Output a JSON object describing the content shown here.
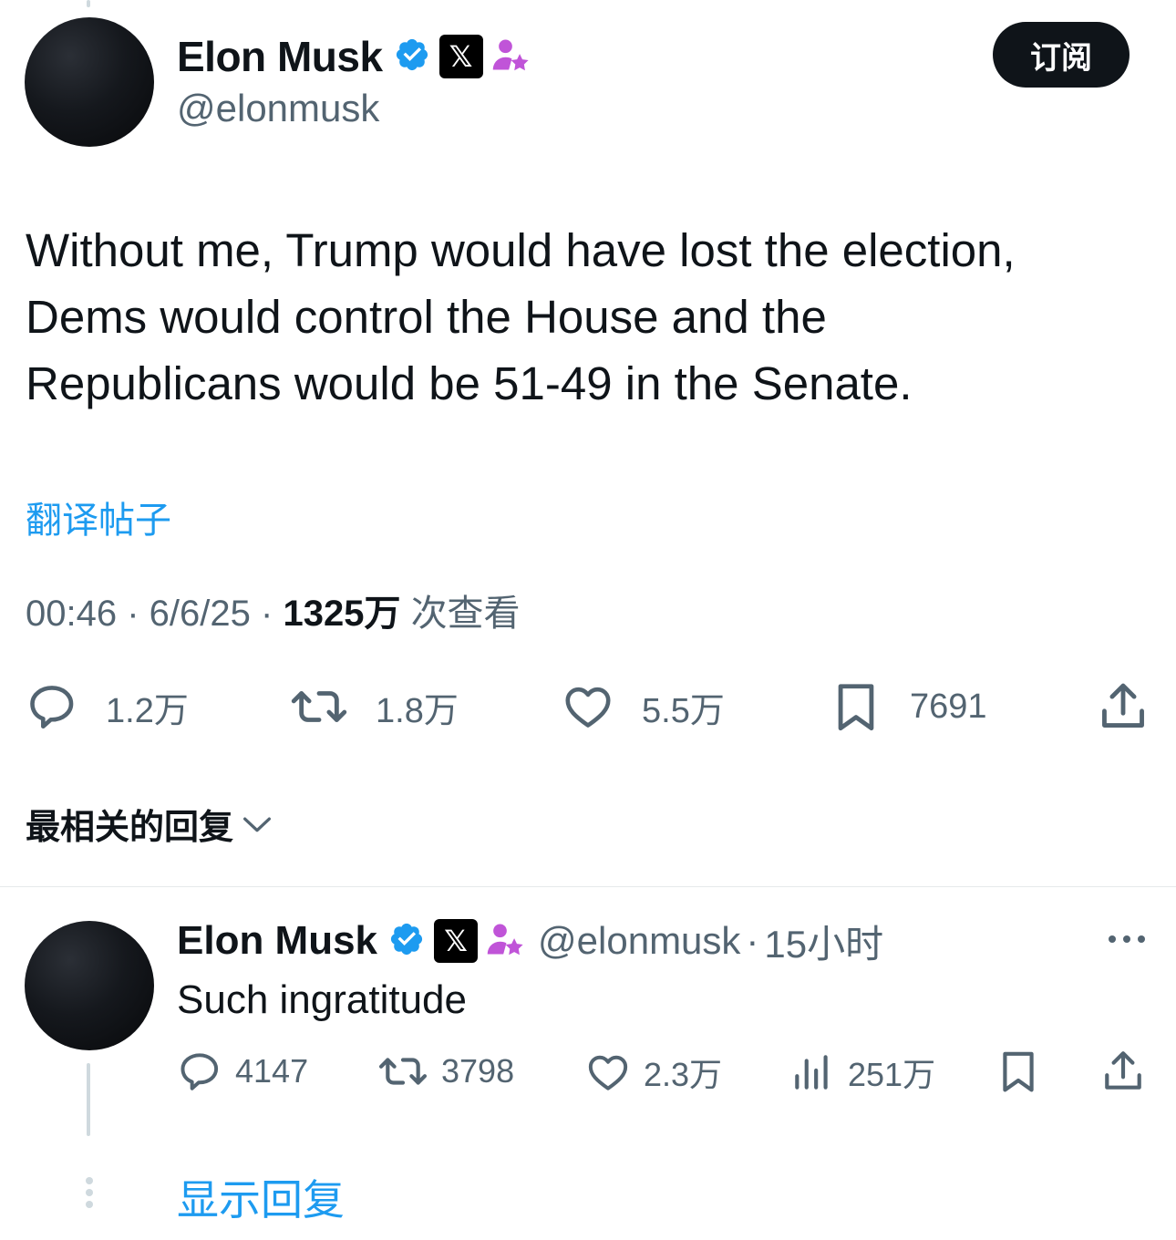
{
  "tweet": {
    "author": {
      "name": "Elon Musk",
      "handle": "@elonmusk"
    },
    "subscribe_label": "订阅",
    "text_lines": [
      "Without me, Trump would have lost the election,",
      "Dems would control the House and the",
      "Republicans would be 51-49 in the Senate."
    ],
    "translate_label": "翻译帖子",
    "time": "00:46",
    "date": "6/6/25",
    "views_count": "1325万",
    "views_label": "次查看",
    "stats": {
      "replies": "1.2万",
      "reposts": "1.8万",
      "likes": "5.5万",
      "bookmarks": "7691"
    }
  },
  "replies_sort": {
    "label": "最相关的回复"
  },
  "reply": {
    "author": {
      "name": "Elon Musk",
      "handle": "@elonmusk"
    },
    "sep": "·",
    "time_ago": "15小时",
    "text": "Such ingratitude",
    "stats": {
      "replies": "4147",
      "reposts": "3798",
      "likes": "2.3万",
      "views": "251万"
    },
    "show_replies_label": "显示回复"
  },
  "icons": {
    "verified": "verified-badge-icon",
    "x_org": "x-logo-icon",
    "affiliate": "affiliate-person-star-icon",
    "reply": "speech-bubble-icon",
    "repost": "repost-arrows-icon",
    "like": "heart-icon",
    "bookmark": "bookmark-icon",
    "share": "share-upload-icon",
    "views": "bar-chart-icon",
    "more": "more-dots-icon",
    "chevron": "chevron-down-icon"
  },
  "colors": {
    "text": "#0f1419",
    "secondary": "#536471",
    "link": "#1d9bf0",
    "verified": "#1d9bf0",
    "affiliate": "#c054d8"
  }
}
